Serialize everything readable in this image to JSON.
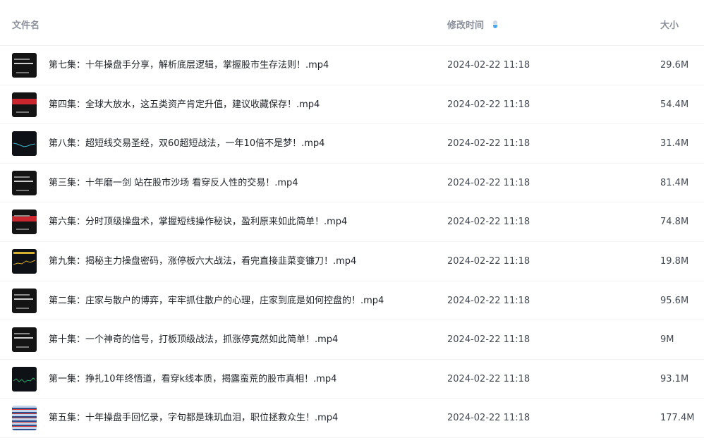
{
  "columns": {
    "name": "文件名",
    "time": "修改时间",
    "size": "大小"
  },
  "files": [
    {
      "name": "第七集：十年操盘手分享，解析底层逻辑，掌握股市生存法则！.mp4",
      "time": "2024-02-22 11:18",
      "size": "29.6M"
    },
    {
      "name": "第四集：全球大放水，这五类资产肯定升值，建议收藏保存！.mp4",
      "time": "2024-02-22 11:18",
      "size": "54.4M"
    },
    {
      "name": "第八集：超短线交易圣经，双60超短战法，一年10倍不是梦！.mp4",
      "time": "2024-02-22 11:18",
      "size": "31.4M"
    },
    {
      "name": "第三集：十年磨一剑 站在股市沙场 看穿反人性的交易！.mp4",
      "time": "2024-02-22 11:18",
      "size": "81.4M"
    },
    {
      "name": "第六集：分时顶级操盘术，掌握短线操作秘诀，盈利原来如此简单！.mp4",
      "time": "2024-02-22 11:18",
      "size": "74.8M"
    },
    {
      "name": "第九集：揭秘主力操盘密码，涨停板六大战法，看完直接韭菜变镰刀！.mp4",
      "time": "2024-02-22 11:18",
      "size": "19.8M"
    },
    {
      "name": "第二集：庄家与散户的博弈，牢牢抓住散户的心理，庄家到底是如何控盘的！.mp4",
      "time": "2024-02-22 11:18",
      "size": "95.6M"
    },
    {
      "name": "第十集：一个神奇的信号，打板顶级战法，抓涨停竟然如此简单！.mp4",
      "time": "2024-02-22 11:18",
      "size": "9M"
    },
    {
      "name": "第一集：挣扎10年终悟道，看穿k线本质，揭露蛮荒的股市真相！.mp4",
      "time": "2024-02-22 11:18",
      "size": "93.1M"
    },
    {
      "name": "第五集：十年操盘手回忆录，字句都是珠玑血泪，职位拯救众生！.mp4",
      "time": "2024-02-22 11:18",
      "size": "177.4M"
    }
  ]
}
